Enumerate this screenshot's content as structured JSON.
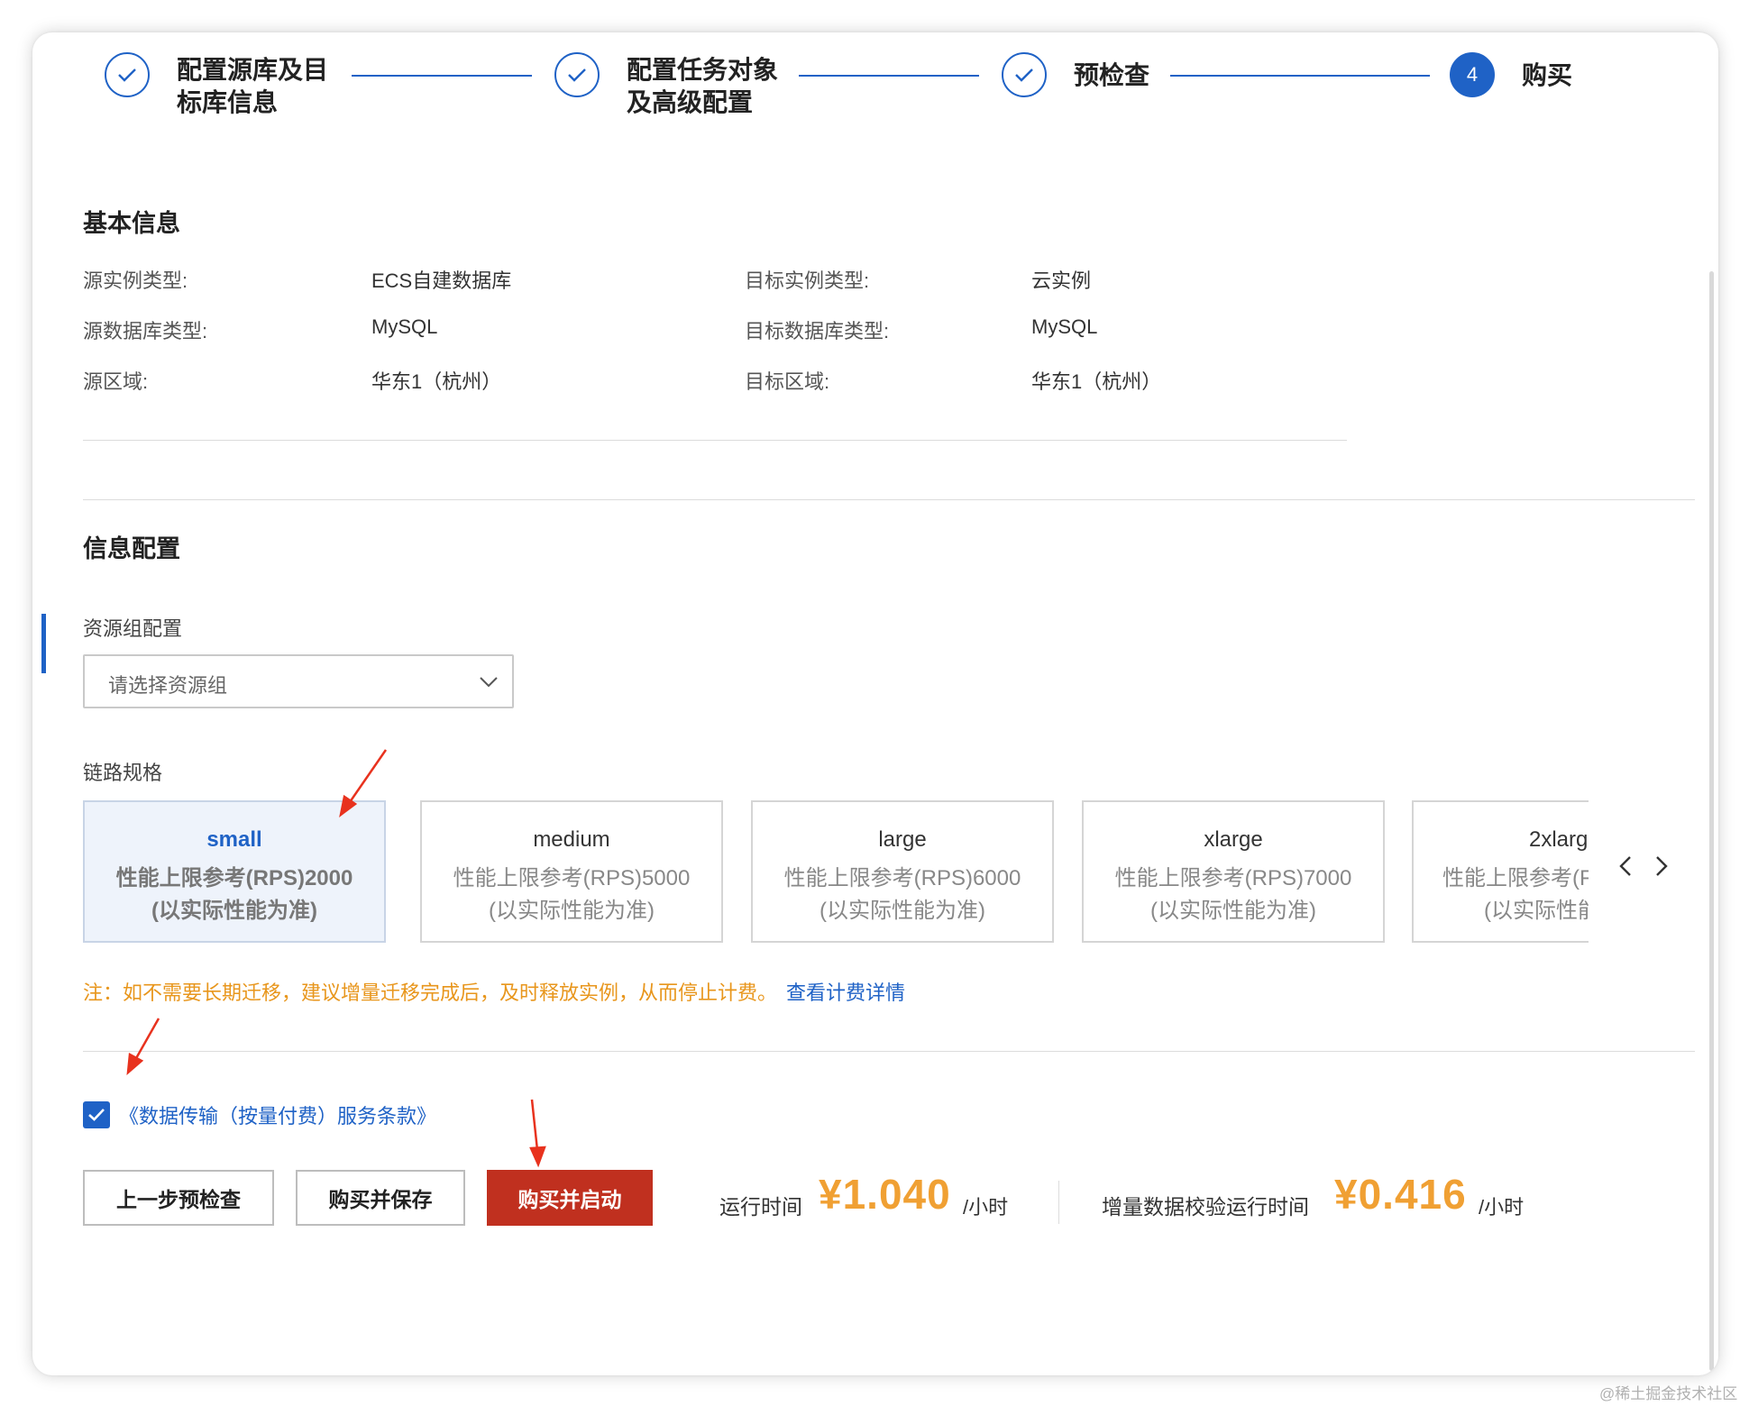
{
  "steps": [
    {
      "line1": "配置源库及目",
      "line2": "标库信息",
      "status": "done"
    },
    {
      "line1": "配置任务对象",
      "line2": "及高级配置",
      "status": "done"
    },
    {
      "line1": "预检查",
      "line2": "",
      "status": "done"
    },
    {
      "number": "4",
      "line1": "购买",
      "line2": "",
      "status": "active"
    }
  ],
  "basic": {
    "title": "基本信息",
    "rows": [
      {
        "left_label": "源实例类型:",
        "left_value": "ECS自建数据库",
        "right_label": "目标实例类型:",
        "right_value": "云实例"
      },
      {
        "left_label": "源数据库类型:",
        "left_value": "MySQL",
        "right_label": "目标数据库类型:",
        "right_value": "MySQL"
      },
      {
        "left_label": "源区域:",
        "left_value": "华东1（杭州）",
        "right_label": "目标区域:",
        "right_value": "华东1（杭州）"
      }
    ]
  },
  "config": {
    "title": "信息配置",
    "resource_group_label": "资源组配置",
    "resource_group_placeholder": "请选择资源组",
    "spec_label": "链路规格",
    "specs": [
      {
        "name": "small",
        "perf": "性能上限参考(RPS)2000",
        "note": "(以实际性能为准)",
        "selected": true
      },
      {
        "name": "medium",
        "perf": "性能上限参考(RPS)5000",
        "note": "(以实际性能为准)",
        "selected": false
      },
      {
        "name": "large",
        "perf": "性能上限参考(RPS)6000",
        "note": "(以实际性能为准)",
        "selected": false
      },
      {
        "name": "xlarge",
        "perf": "性能上限参考(RPS)7000",
        "note": "(以实际性能为准)",
        "selected": false
      },
      {
        "name": "2xlarg",
        "perf": "性能上限参考(F",
        "note": "(以实际性能",
        "selected": false
      }
    ],
    "note_text": "注：如不需要长期迁移，建议增量迁移完成后，及时释放实例，从而停止计费。",
    "note_link": "查看计费详情"
  },
  "agreement": {
    "checked": true,
    "text": "《数据传输（按量付费）服务条款》"
  },
  "actions": {
    "prev": "上一步预检查",
    "save": "购买并保存",
    "start": "购买并启动"
  },
  "pricing": {
    "run_label": "运行时间",
    "run_price": "¥1.040",
    "run_unit": "/小时",
    "verify_label": "增量数据校验运行时间",
    "verify_price": "¥0.416",
    "verify_unit": "/小时"
  },
  "watermark": "@稀土掘金技术社区",
  "colors": {
    "primary": "#1f62c6",
    "danger": "#c0301f",
    "price": "#f0a033",
    "note": "#e8961c"
  }
}
